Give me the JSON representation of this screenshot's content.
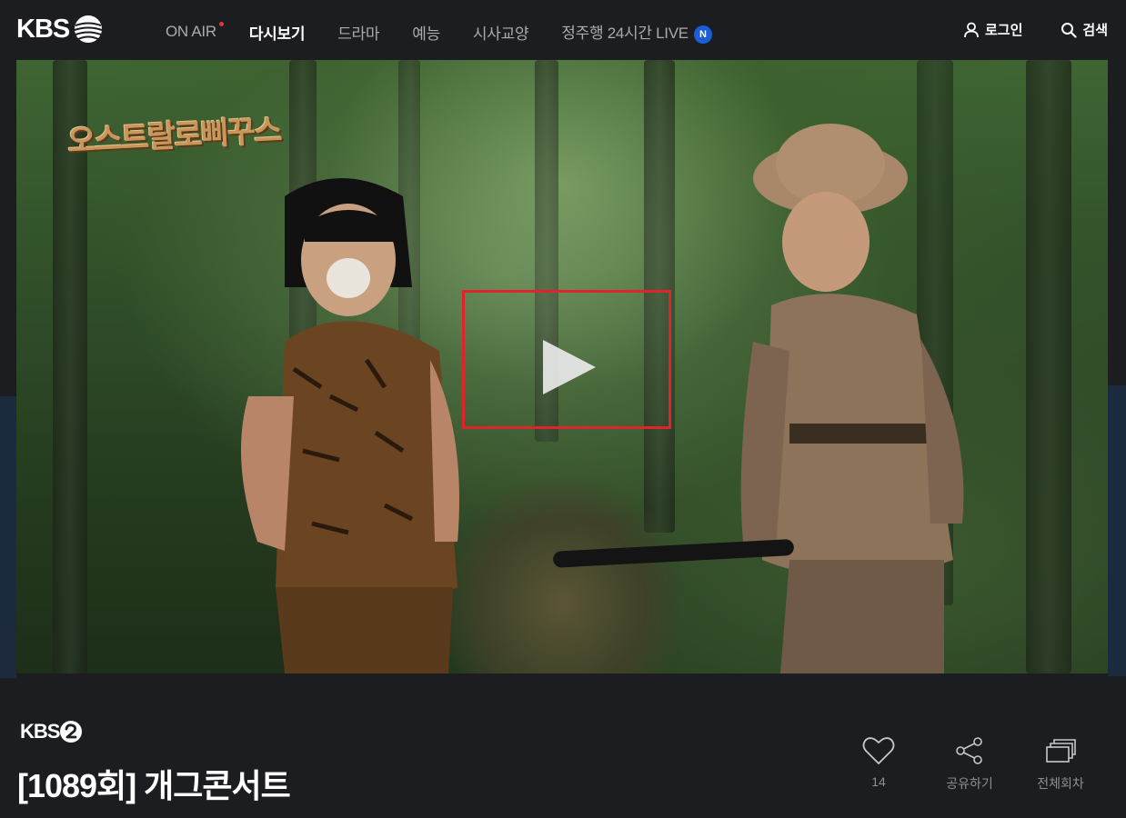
{
  "brand": {
    "logo_text": "KBS",
    "channel_logo_text": "KBS"
  },
  "nav": {
    "items": [
      {
        "label": "ON AIR"
      },
      {
        "label": "다시보기"
      },
      {
        "label": "드라마"
      },
      {
        "label": "예능"
      },
      {
        "label": "시사교양"
      },
      {
        "label": "정주행 24시간 LIVE",
        "badge": "N"
      }
    ],
    "active_index": 1
  },
  "header_right": {
    "login_label": "로그인",
    "search_label": "검색"
  },
  "video": {
    "show_logo_text": "오스트랄로삐꾸스"
  },
  "episode": {
    "title": "[1089회] 개그콘서트"
  },
  "actions": {
    "like_count": "14",
    "share_label": "공유하기",
    "all_episodes_label": "전체회차"
  },
  "colors": {
    "background": "#1c1d21",
    "highlight_frame": "#e0242b",
    "badge": "#1a5dd6",
    "onair_dot": "#e8323c"
  }
}
